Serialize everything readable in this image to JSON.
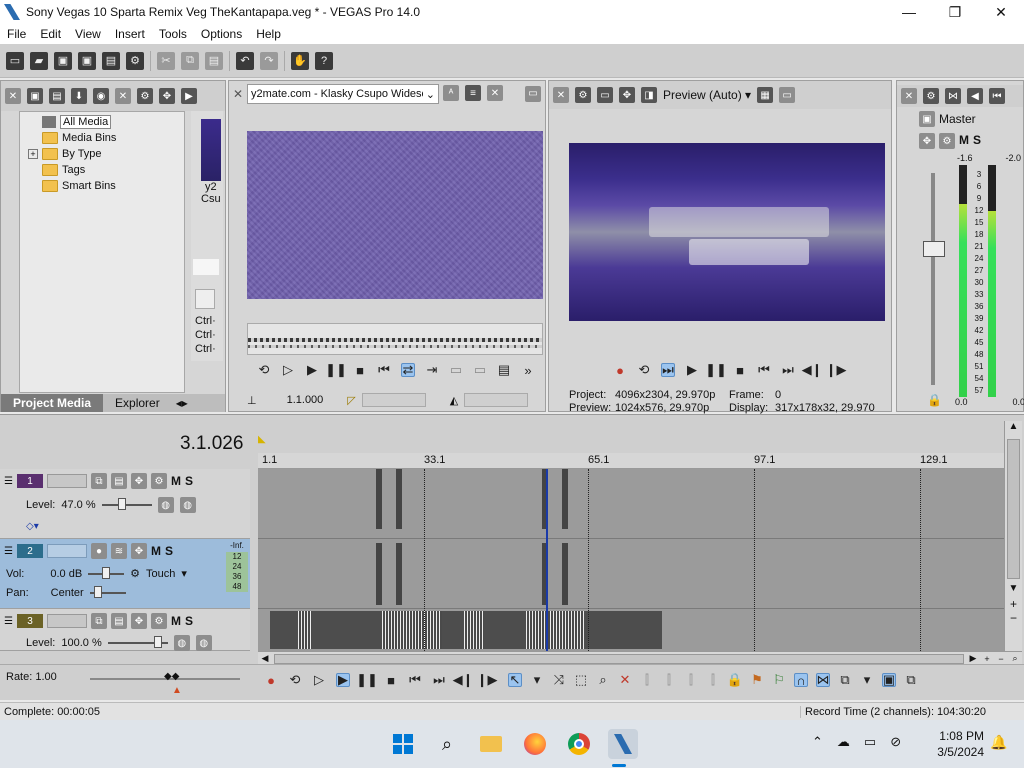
{
  "window": {
    "title": "Sony Vegas 10 Sparta Remix Veg TheKantapapa.veg * - VEGAS Pro 14.0",
    "controls": [
      "—",
      "❐",
      "✕"
    ]
  },
  "menu": [
    "File",
    "Edit",
    "View",
    "Insert",
    "Tools",
    "Options",
    "Help"
  ],
  "project_media": {
    "tree": [
      "All Media",
      "Media Bins",
      "By Type",
      "Tags",
      "Smart Bins"
    ],
    "thumb_caption_1": "y2",
    "thumb_caption_2": "Csu",
    "ctrl_lines": [
      "Ctrl·",
      "Ctrl·",
      "Ctrl·"
    ],
    "tabs": [
      "Project Media",
      "Explorer"
    ]
  },
  "trimmer": {
    "source": "y2mate.com - Klasky Csupo Widesc",
    "time": "1.1.000"
  },
  "preview": {
    "mode": "Preview (Auto)",
    "project_label": "Project:",
    "project_value": "4096x2304, 29.970p",
    "preview_label": "Preview:",
    "preview_value": "1024x576, 29.970p",
    "frame_label": "Frame:",
    "frame_value": "0",
    "display_label": "Display:",
    "display_value": "317x178x32, 29.970"
  },
  "master": {
    "label": "Master",
    "peak_left": "-1.6",
    "peak_right": "-2.0",
    "scale": [
      "3",
      "6",
      "9",
      "12",
      "15",
      "18",
      "21",
      "24",
      "27",
      "30",
      "33",
      "36",
      "39",
      "42",
      "45",
      "48",
      "51",
      "54",
      "57"
    ],
    "bottom_left": "0.0",
    "bottom_right": "0.0",
    "level_left": 0.83,
    "level_right": 0.8
  },
  "timeline": {
    "time": "3.1.026",
    "ruler": [
      "1.1",
      "33.1",
      "65.1",
      "97.1",
      "129.1"
    ]
  },
  "tracks": [
    {
      "num": "1",
      "level_label": "Level:",
      "level_value": "47.0 %"
    },
    {
      "num": "2",
      "vol_label": "Vol:",
      "vol_value": "0.0 dB",
      "pan_label": "Pan:",
      "pan_value": "Center",
      "mode": "Touch",
      "inf": "-Inf.",
      "meter_scale": [
        "12",
        "24",
        "36",
        "48"
      ]
    },
    {
      "num": "3",
      "level_label": "Level:",
      "level_value": "100.0 %"
    }
  ],
  "rate": "Rate: 1.00",
  "status": {
    "complete": "Complete: 00:00:05",
    "record_time": "Record Time (2 channels): 104:30:20"
  },
  "taskbar": {
    "time": "1:08 PM",
    "date": "3/5/2024"
  },
  "colors": {
    "accent": "#2b6cb0",
    "video_bg": "#6f5fae",
    "selected_track": "#9dbcdb",
    "meter_green": "#32d14a"
  }
}
